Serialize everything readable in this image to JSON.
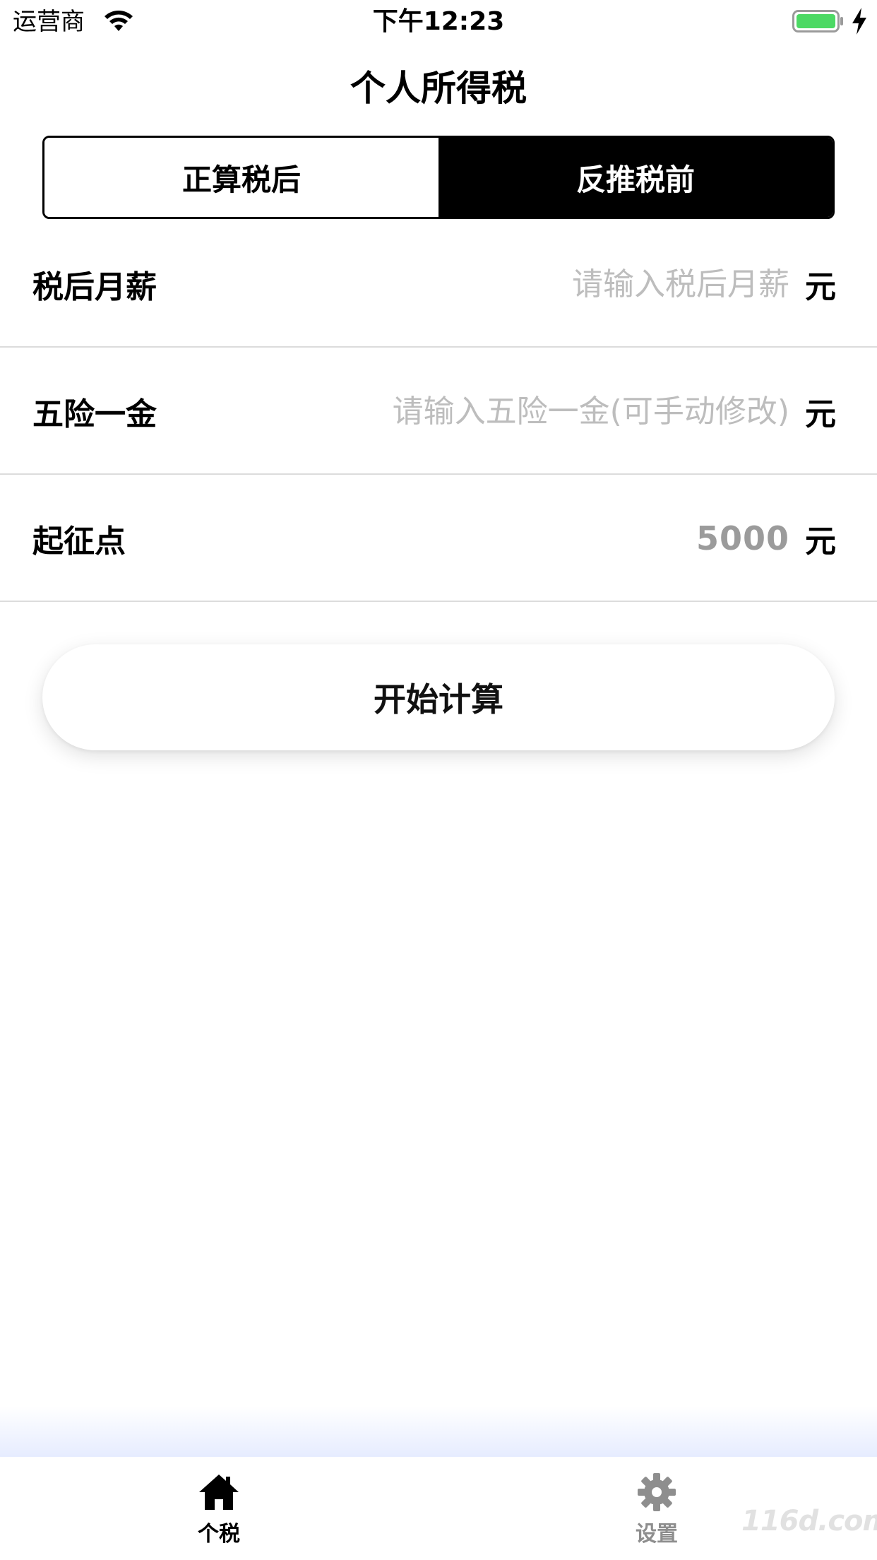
{
  "status_bar": {
    "carrier": "运营商",
    "time": "下午12:23"
  },
  "nav": {
    "title": "个人所得税"
  },
  "segmented": {
    "options": [
      "正算税后",
      "反推税前"
    ],
    "selected_index": 1
  },
  "form": {
    "rows": [
      {
        "label": "税后月薪",
        "placeholder": "请输入税后月薪",
        "value": "",
        "unit": "元"
      },
      {
        "label": "五险一金",
        "placeholder": "请输入五险一金(可手动修改)",
        "value": "",
        "unit": "元"
      },
      {
        "label": "起征点",
        "value": "5000",
        "unit": "元"
      }
    ]
  },
  "calculate_button": {
    "label": "开始计算"
  },
  "tab_bar": {
    "items": [
      {
        "label": "个税",
        "icon": "home-icon",
        "active": true
      },
      {
        "label": "设置",
        "icon": "gear-icon",
        "active": false
      }
    ]
  },
  "watermark": "116d.com",
  "colors": {
    "accent": "#000000",
    "placeholder": "#bdbdbd",
    "battery": "#4cd964",
    "inactive_tab": "#8e8e8e"
  }
}
